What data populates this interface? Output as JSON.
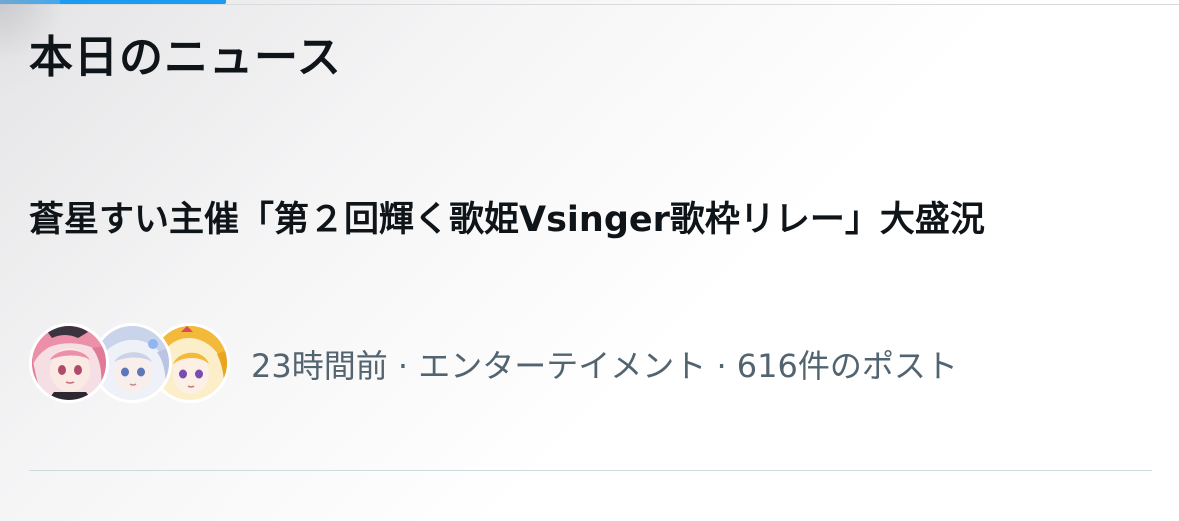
{
  "section": {
    "title": "本日のニュース"
  },
  "news_item": {
    "headline": "蒼星すい主催「第２回輝く歌姫Vsinger歌枠リレー」大盛況",
    "meta": {
      "time_ago": "23時間前",
      "category": "エンターテイメント",
      "post_count": "616件のポスト",
      "separator": " · "
    },
    "avatars": [
      {
        "name": "avatar-pink-hair",
        "accent": "#f0a6b8"
      },
      {
        "name": "avatar-silver-hair",
        "accent": "#cdd6ea"
      },
      {
        "name": "avatar-blonde-hair",
        "accent": "#f2b93b"
      }
    ]
  },
  "colors": {
    "primary_text": "#0f1419",
    "secondary_text": "#536471",
    "accent": "#1d9bf0",
    "divider": "#cfd9de"
  }
}
